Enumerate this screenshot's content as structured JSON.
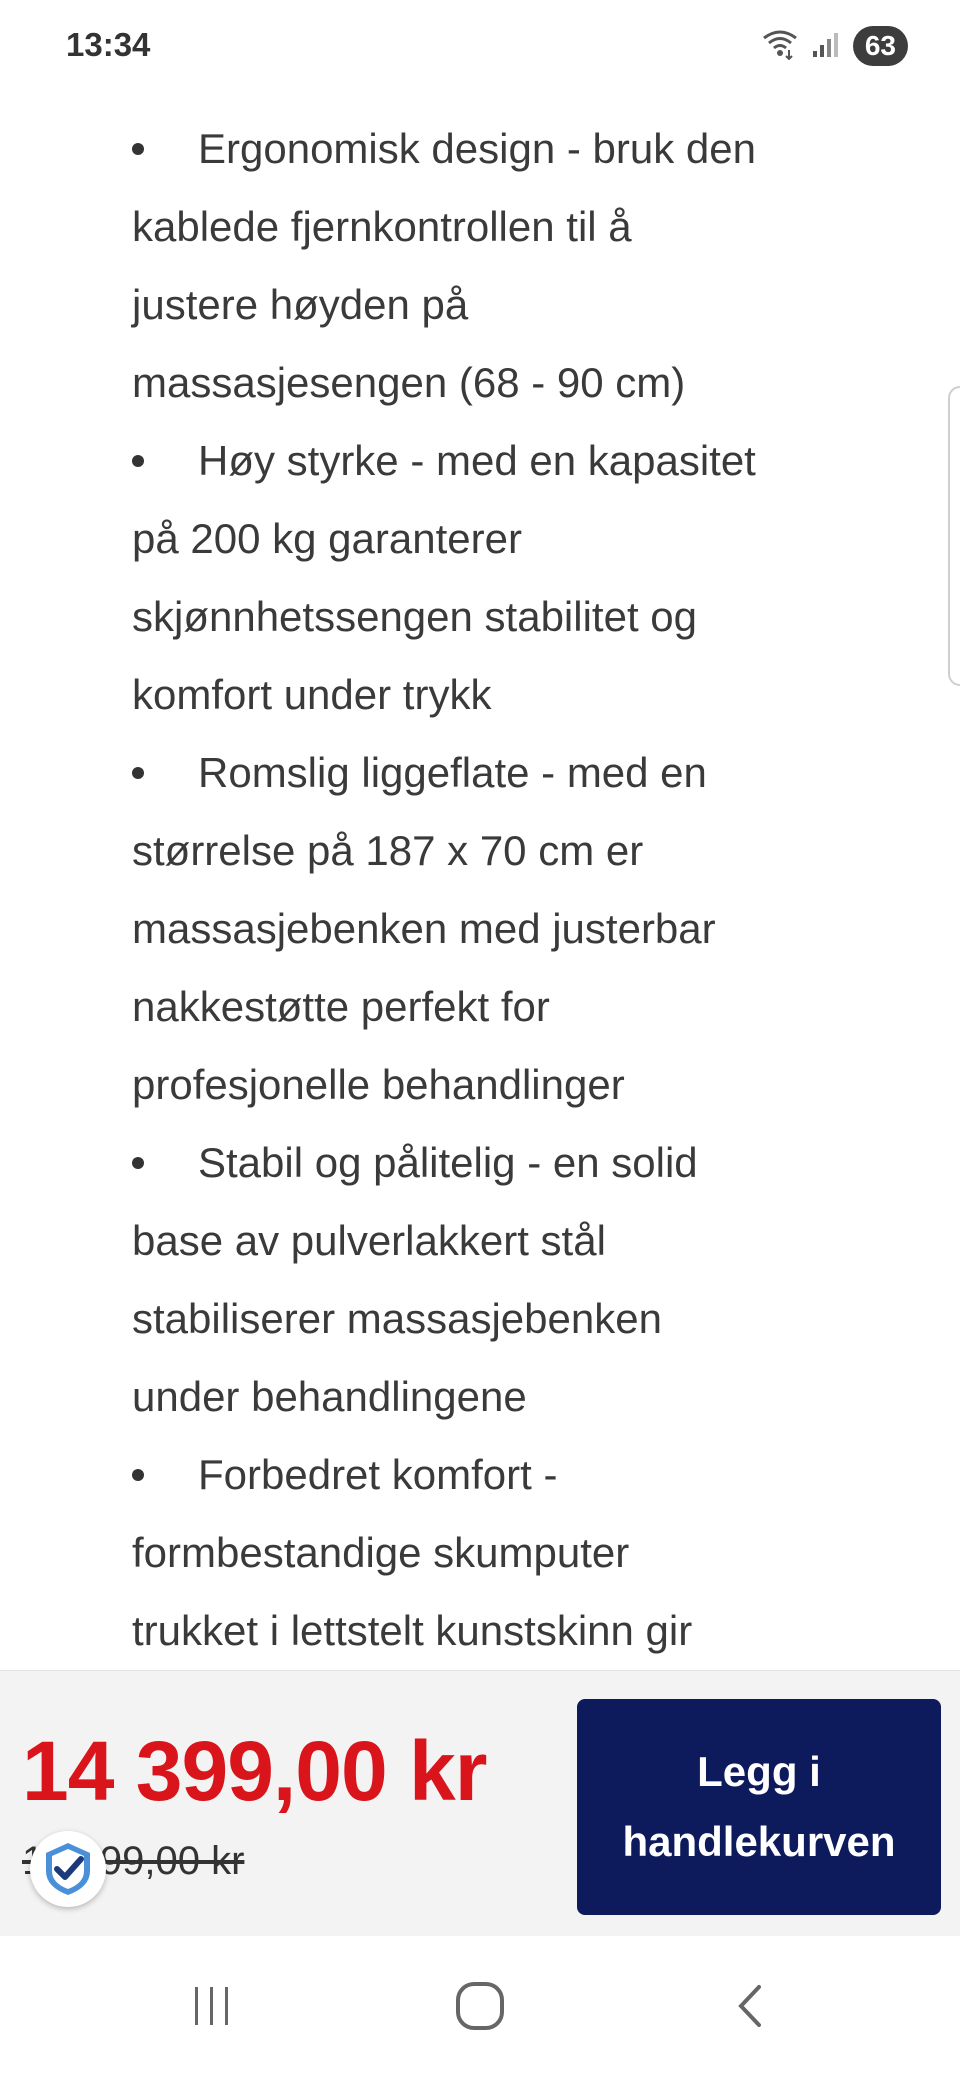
{
  "status_bar": {
    "time": "13:34",
    "battery_level": "63",
    "icons": [
      "wifi-icon",
      "signal-icon",
      "battery-icon"
    ]
  },
  "product_features": [
    {
      "lines": [
        "Ergonomisk design - bruk den",
        "kablede fjernkontrollen til å",
        "justere høyden på",
        "massasjesengen (68 - 90 cm)"
      ]
    },
    {
      "lines": [
        "Høy styrke - med en kapasitet",
        "på 200 kg garanterer",
        "skjønnhetssengen stabilitet og",
        "komfort under trykk"
      ]
    },
    {
      "lines": [
        "Romslig liggeflate - med en",
        "størrelse på 187 x 70 cm er",
        "massasjebenken med justerbar",
        "nakkestøtte perfekt for",
        "profesjonelle behandlinger"
      ]
    },
    {
      "lines": [
        "Stabil og pålitelig - en solid",
        "base av pulverlakkert stål",
        "stabiliserer massasjebenken",
        "under behandlingene"
      ]
    },
    {
      "lines": [
        "Forbedret komfort -",
        "formbestandige skumputer",
        "trukket i lettstelt kunstskinn gir"
      ]
    }
  ],
  "purchase": {
    "price": "14 399,00 kr",
    "old_price": "17 099,00 kr",
    "cart_button_label": "Legg i\nhandlekurven"
  },
  "colors": {
    "price": "#d9141b",
    "button": "#0d1a5c"
  },
  "nav": {
    "icons": [
      "recent-apps-icon",
      "home-icon",
      "back-icon"
    ]
  }
}
